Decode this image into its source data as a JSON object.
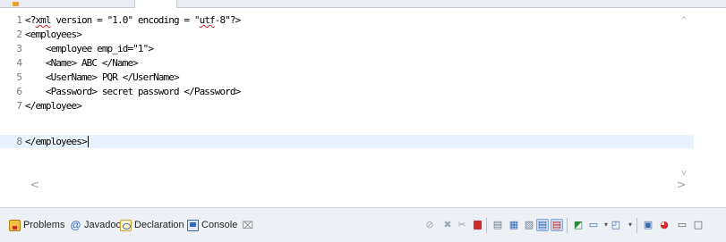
{
  "editor": {
    "lines": [
      {
        "num": "1",
        "pre": "<?",
        "squig": "xml",
        "post": " version = \"1.0\" encoding = \"",
        "squig2": "utf",
        "post2": "-8\"?>"
      },
      {
        "num": "2",
        "text": "<employees>"
      },
      {
        "num": "3",
        "text": "    <employee emp_id=\"1\">"
      },
      {
        "num": "4",
        "text": "    <Name> ABC </Name>"
      },
      {
        "num": "5",
        "text": "    <UserName> PQR </UserName>"
      },
      {
        "num": "6",
        "text": "    <Password> secret password </Password>"
      },
      {
        "num": "7",
        "text": "</employee>"
      },
      {
        "num": "8",
        "text": "</employees>"
      }
    ],
    "current_line": 8
  },
  "scroll": {
    "up": "^",
    "down": "v",
    "left": "<",
    "right": ">"
  },
  "panel": {
    "tabs": [
      {
        "label": "Problems",
        "icon": "problems-icon"
      },
      {
        "label": "Javadoc",
        "icon": "javadoc-at-icon"
      },
      {
        "label": "Declaration",
        "icon": "declaration-icon"
      },
      {
        "label": "Console",
        "icon": "console-icon",
        "active": true
      }
    ],
    "close_glyph": "⌧",
    "javadoc_glyph": "@",
    "minimize_glyph": "▭",
    "maximize_glyph": "□"
  },
  "colors": {
    "current_line": "#e8f2fe",
    "terminate_red": "#d12a2a",
    "toolbar_bg": "#edf1f6"
  }
}
